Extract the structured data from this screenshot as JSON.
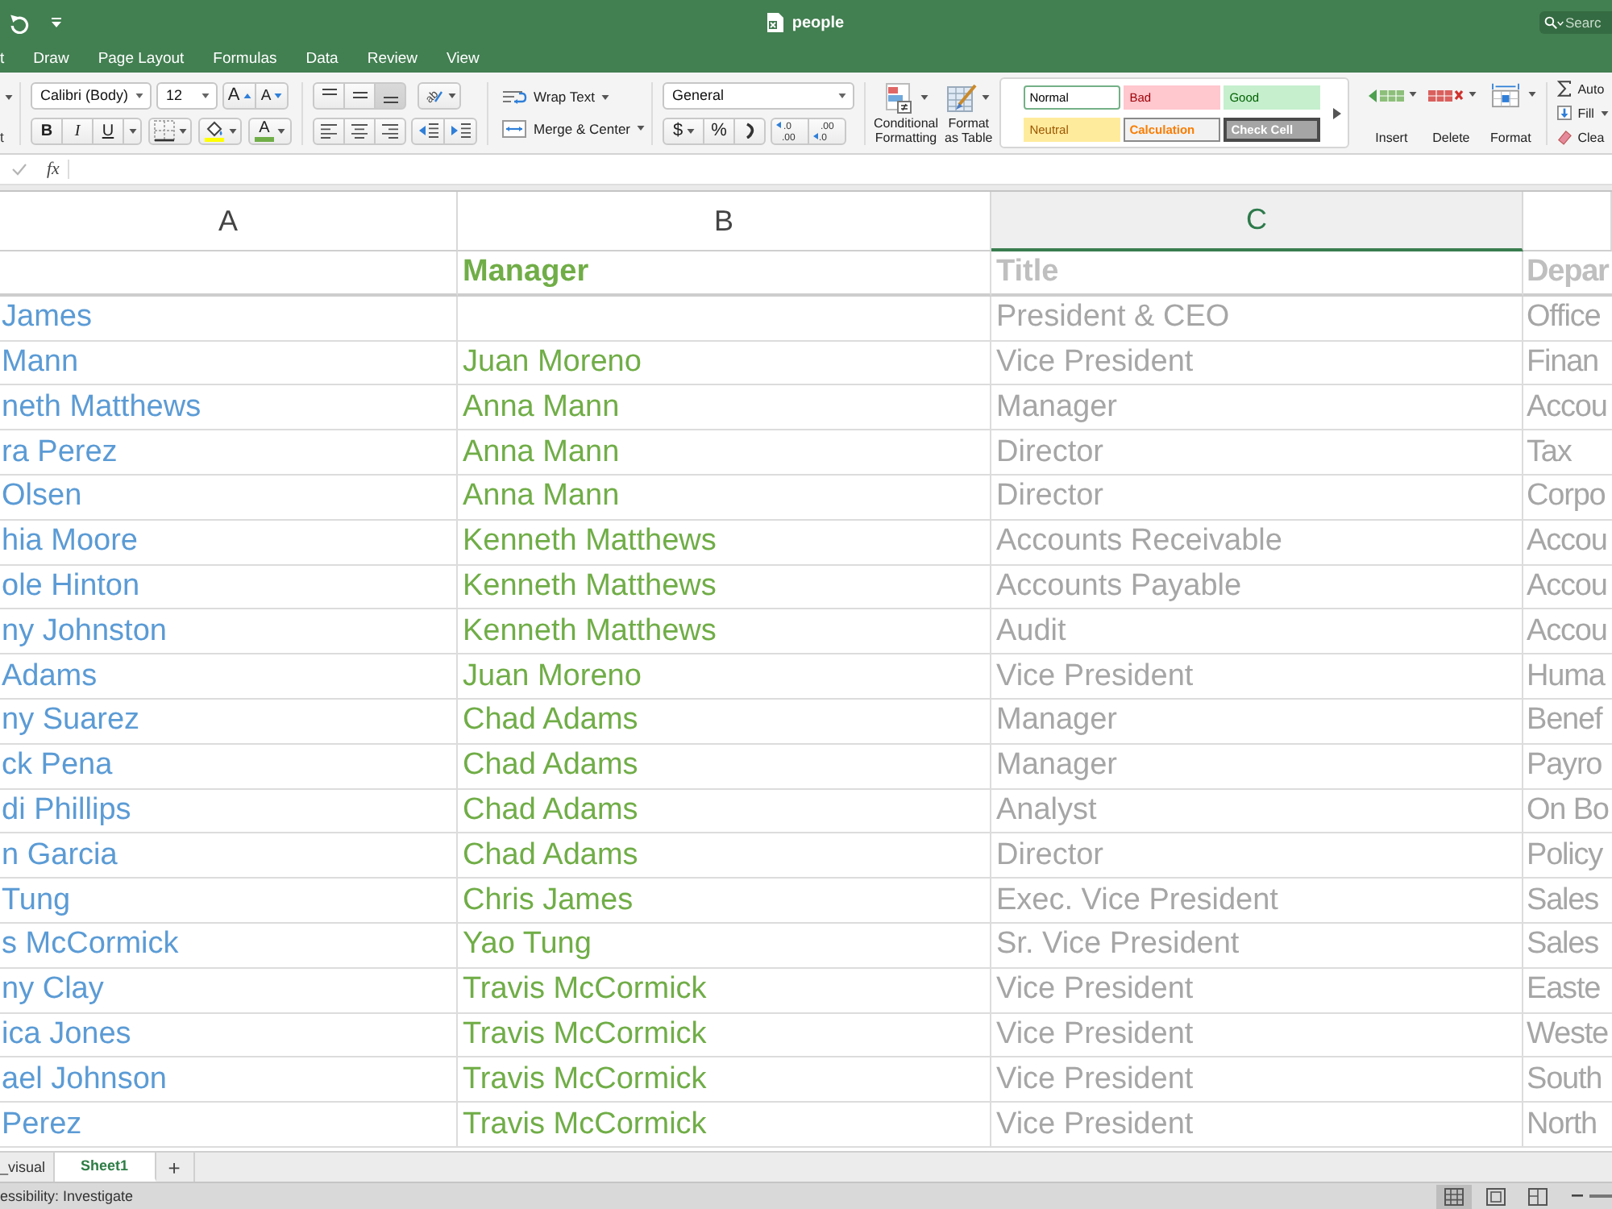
{
  "title_bar": {
    "document": "people",
    "search_placeholder": "Searc"
  },
  "menu_tabs": [
    "t",
    "Draw",
    "Page Layout",
    "Formulas",
    "Data",
    "Review",
    "View"
  ],
  "ribbon": {
    "clipboard_label": "t",
    "font": {
      "name": "Calibri (Body)",
      "size": "12",
      "grow": "A",
      "shrink": "A",
      "styles": [
        {
          "kind": "bold",
          "label": "B"
        },
        {
          "kind": "italic",
          "label": "I"
        },
        {
          "kind": "underline",
          "label": "U"
        }
      ],
      "font_color": "A"
    },
    "vertical_align": [
      {
        "kind": "top",
        "selected": false
      },
      {
        "kind": "middle",
        "selected": false
      },
      {
        "kind": "bottom",
        "selected": true
      }
    ],
    "orientation": "ab",
    "horizontal_align": [
      {
        "kind": "left"
      },
      {
        "kind": "center"
      },
      {
        "kind": "right"
      }
    ],
    "indent": [
      {
        "kind": "decrease"
      },
      {
        "kind": "increase"
      }
    ],
    "wrap_text": "Wrap Text",
    "merge_center": "Merge & Center",
    "number_format": "General",
    "currency": "$",
    "percent": "%",
    "decimal_buttons": [
      {
        "kind": "increase",
        "top": ".0",
        "bottom": ".00"
      },
      {
        "kind": "decrease",
        "top": ".00",
        "bottom": ".0"
      }
    ],
    "format_buttons": [
      {
        "kind": "conditional",
        "lines": [
          "Conditional",
          "Formatting"
        ]
      },
      {
        "kind": "table",
        "lines": [
          "Format",
          "as Table"
        ]
      }
    ],
    "cell_styles": [
      {
        "kind": "normal",
        "label": "Normal",
        "selected": true
      },
      {
        "kind": "bad",
        "label": "Bad",
        "selected": false
      },
      {
        "kind": "good",
        "label": "Good",
        "selected": false
      },
      {
        "kind": "neutral",
        "label": "Neutral",
        "selected": false
      },
      {
        "kind": "calculation",
        "label": "Calculation",
        "selected": false
      },
      {
        "kind": "check",
        "label": "Check Cell",
        "selected": false
      }
    ],
    "cell_buttons": [
      {
        "kind": "insert",
        "label": "Insert"
      },
      {
        "kind": "delete",
        "label": "Delete"
      },
      {
        "kind": "format",
        "label": "Format"
      }
    ],
    "editing": [
      {
        "kind": "sum",
        "label": "Auto"
      },
      {
        "kind": "fill",
        "label": "Fill"
      },
      {
        "kind": "clear",
        "label": "Clea"
      }
    ]
  },
  "formula_bar": {
    "function_label": "fx"
  },
  "sheet": {
    "columns": [
      {
        "letter": "A",
        "selected": false
      },
      {
        "letter": "B",
        "selected": false
      },
      {
        "letter": "C",
        "selected": true
      }
    ],
    "rows": [
      {
        "kind": "header",
        "manager": "Manager",
        "title": "Title",
        "column_4": "Depar"
      },
      {
        "kind": "data",
        "column_1": "James",
        "title": "President & CEO",
        "column_4": "Office"
      },
      {
        "kind": "data",
        "column_1": "Mann",
        "manager": "Juan Moreno",
        "title": "Vice President",
        "column_4": "Finan"
      },
      {
        "kind": "data",
        "column_1": "neth Matthews",
        "manager": "Anna Mann",
        "title": "Manager",
        "column_4": "Accou"
      },
      {
        "kind": "data",
        "column_1": "ra Perez",
        "manager": "Anna Mann",
        "title": "Director",
        "column_4": "Tax"
      },
      {
        "kind": "data",
        "column_1": "Olsen",
        "manager": "Anna Mann",
        "title": "Director",
        "column_4": "Corpo"
      },
      {
        "kind": "data",
        "column_1": "hia Moore",
        "manager": "Kenneth Matthews",
        "title": "Accounts Receivable",
        "column_4": "Accou"
      },
      {
        "kind": "data",
        "column_1": "ole Hinton",
        "manager": "Kenneth Matthews",
        "title": "Accounts Payable",
        "column_4": "Accou"
      },
      {
        "kind": "data",
        "column_1": "ny Johnston",
        "manager": "Kenneth Matthews",
        "title": "Audit",
        "column_4": "Accou"
      },
      {
        "kind": "data",
        "column_1": "Adams",
        "manager": "Juan Moreno",
        "title": "Vice President",
        "column_4": "Huma"
      },
      {
        "kind": "data",
        "column_1": "ny Suarez",
        "manager": "Chad Adams",
        "title": "Manager",
        "column_4": "Benef"
      },
      {
        "kind": "data",
        "column_1": "ck Pena",
        "manager": "Chad Adams",
        "title": "Manager",
        "column_4": "Payro"
      },
      {
        "kind": "data",
        "column_1": "di Phillips",
        "manager": "Chad Adams",
        "title": "Analyst",
        "column_4": "On Bo"
      },
      {
        "kind": "data",
        "column_1": "n Garcia",
        "manager": "Chad Adams",
        "title": "Director",
        "column_4": "Policy"
      },
      {
        "kind": "data",
        "column_1": "Tung",
        "manager": "Chris James",
        "title": "Exec. Vice President",
        "column_4": "Sales"
      },
      {
        "kind": "data",
        "column_1": "s McCormick",
        "manager": "Yao Tung",
        "title": "Sr. Vice President",
        "column_4": "Sales"
      },
      {
        "kind": "data",
        "column_1": "ny Clay",
        "manager": "Travis McCormick",
        "title": "Vice President",
        "column_4": "Easte"
      },
      {
        "kind": "data",
        "column_1": "ica Jones",
        "manager": "Travis McCormick",
        "title": "Vice President",
        "column_4": "Weste"
      },
      {
        "kind": "data",
        "column_1": "ael Johnson",
        "manager": "Travis McCormick",
        "title": "Vice President",
        "column_4": "South"
      },
      {
        "kind": "data",
        "column_1": "Perez",
        "manager": "Travis McCormick",
        "title": "Vice President",
        "column_4": "North"
      }
    ]
  },
  "sheet_tabs": [
    {
      "label": "_visual",
      "selected": false
    },
    {
      "label": "Sheet1",
      "selected": true
    }
  ],
  "add_sheet": "+",
  "status_bar": {
    "text": "essibility: Investigate",
    "views": [
      {
        "kind": "normal",
        "selected": true
      },
      {
        "kind": "page_layout",
        "selected": false
      },
      {
        "kind": "page_break",
        "selected": false
      }
    ]
  }
}
